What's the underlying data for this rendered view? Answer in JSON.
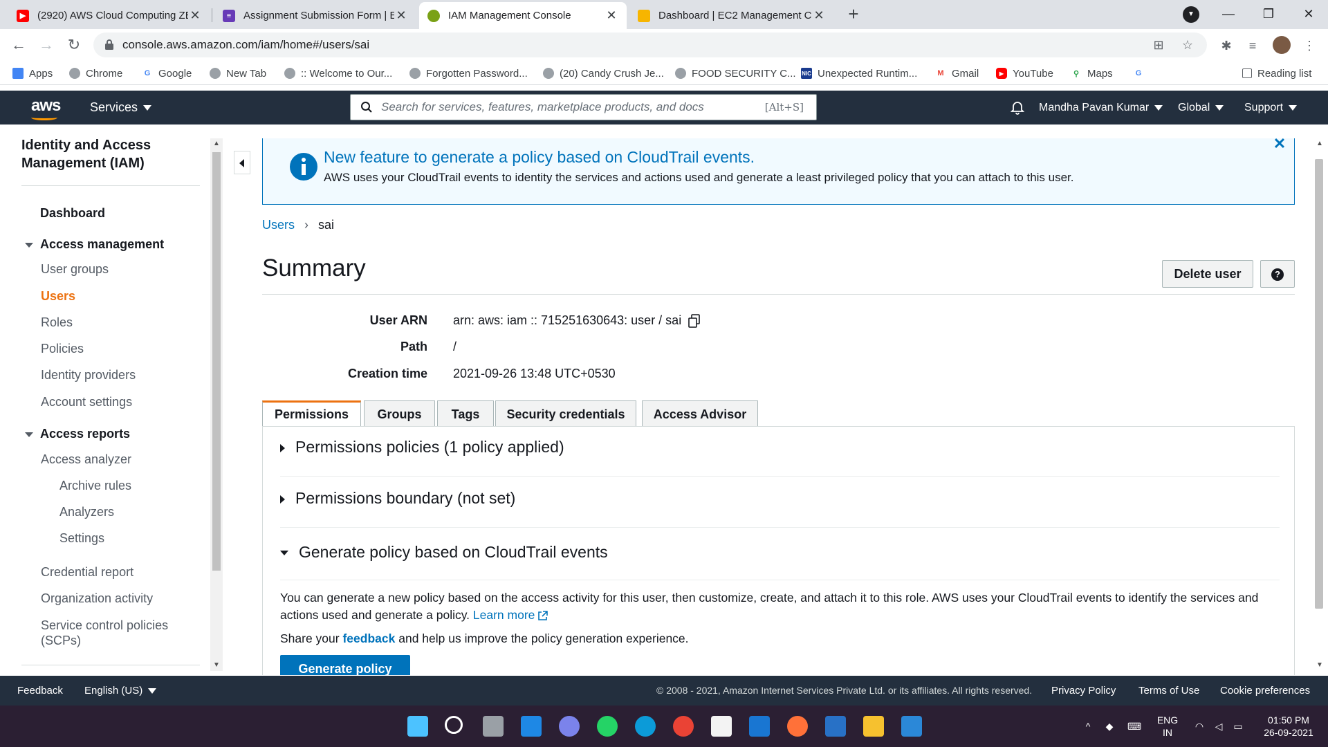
{
  "browser": {
    "tabs": [
      {
        "title": "(2920) AWS Cloud Computing ZE",
        "color": "#ff0000"
      },
      {
        "title": "Assignment Submission Form | E",
        "color": "#673ab7"
      },
      {
        "title": "IAM Management Console",
        "color": "#7aa116"
      },
      {
        "title": "Dashboard | EC2 Management C",
        "color": "#f7b500"
      }
    ],
    "url": "console.aws.amazon.com/iam/home#/users/sai",
    "bookmarks": [
      "Apps",
      "Chrome",
      "Google",
      "New Tab",
      ":: Welcome to Our...",
      "Forgotten Password...",
      "(20) Candy Crush Je...",
      "FOOD SECURITY C...",
      "Unexpected Runtim...",
      "Gmail",
      "YouTube",
      "Maps"
    ],
    "reading_list": "Reading list"
  },
  "aws_header": {
    "logo": "aws",
    "services": "Services",
    "search_placeholder": "Search for services, features, marketplace products, and docs",
    "search_shortcut": "[Alt+S]",
    "user": "Mandha Pavan Kumar",
    "region": "Global",
    "support": "Support"
  },
  "sidebar": {
    "title": "Identity and Access Management (IAM)",
    "dashboard": "Dashboard",
    "access_management": "Access management",
    "am_items": [
      "User groups",
      "Users",
      "Roles",
      "Policies",
      "Identity providers",
      "Account settings"
    ],
    "access_reports": "Access reports",
    "access_analyzer": "Access analyzer",
    "analyzer_items": [
      "Archive rules",
      "Analyzers",
      "Settings"
    ],
    "report_items": [
      "Credential report",
      "Organization activity"
    ],
    "scp_line1": "Service control policies",
    "scp_line2": "(SCPs)"
  },
  "banner": {
    "title": "New feature to generate a policy based on CloudTrail events.",
    "text": "AWS uses your CloudTrail events to identity the services and actions used and generate a least privileged policy that you can attach to this user."
  },
  "breadcrumb": {
    "parent": "Users",
    "current": "sai"
  },
  "summary": {
    "title": "Summary",
    "delete_button": "Delete user",
    "fields": [
      {
        "label": "User ARN",
        "value": "arn: aws: iam :: 715251630643: user / sai"
      },
      {
        "label": "Path",
        "value": "/"
      },
      {
        "label": "Creation time",
        "value": "2021-09-26 13:48 UTC+0530"
      }
    ]
  },
  "tabs": [
    "Permissions",
    "Groups",
    "Tags",
    "Security credentials",
    "Access Advisor"
  ],
  "permissions": {
    "policies": "Permissions policies (1 policy applied)",
    "boundary": "Permissions boundary (not set)",
    "generate_header": "Generate policy based on CloudTrail events",
    "generate_text": "You can generate a new policy based on the access activity for this user, then customize, create, and attach it to this role. AWS uses your CloudTrail events to identify the services and actions used and generate a policy.",
    "learn_more": "Learn more",
    "share_prefix": "Share your",
    "share_link": "feedback",
    "share_suffix": "and help us improve the policy generation experience.",
    "generate_button": "Generate policy"
  },
  "footer": {
    "feedback": "Feedback",
    "language": "English (US)",
    "copyright": "© 2008 - 2021, Amazon Internet Services Private Ltd. or its affiliates. All rights reserved.",
    "privacy": "Privacy Policy",
    "terms": "Terms of Use",
    "cookies": "Cookie preferences"
  },
  "taskbar": {
    "lang1": "ENG",
    "lang2": "IN",
    "time": "01:50 PM",
    "date": "26-09-2021"
  },
  "colors": {
    "aws_dark": "#232f3e",
    "aws_orange": "#ec7211",
    "link_blue": "#0073bb",
    "banner_bg": "#f1faff"
  }
}
